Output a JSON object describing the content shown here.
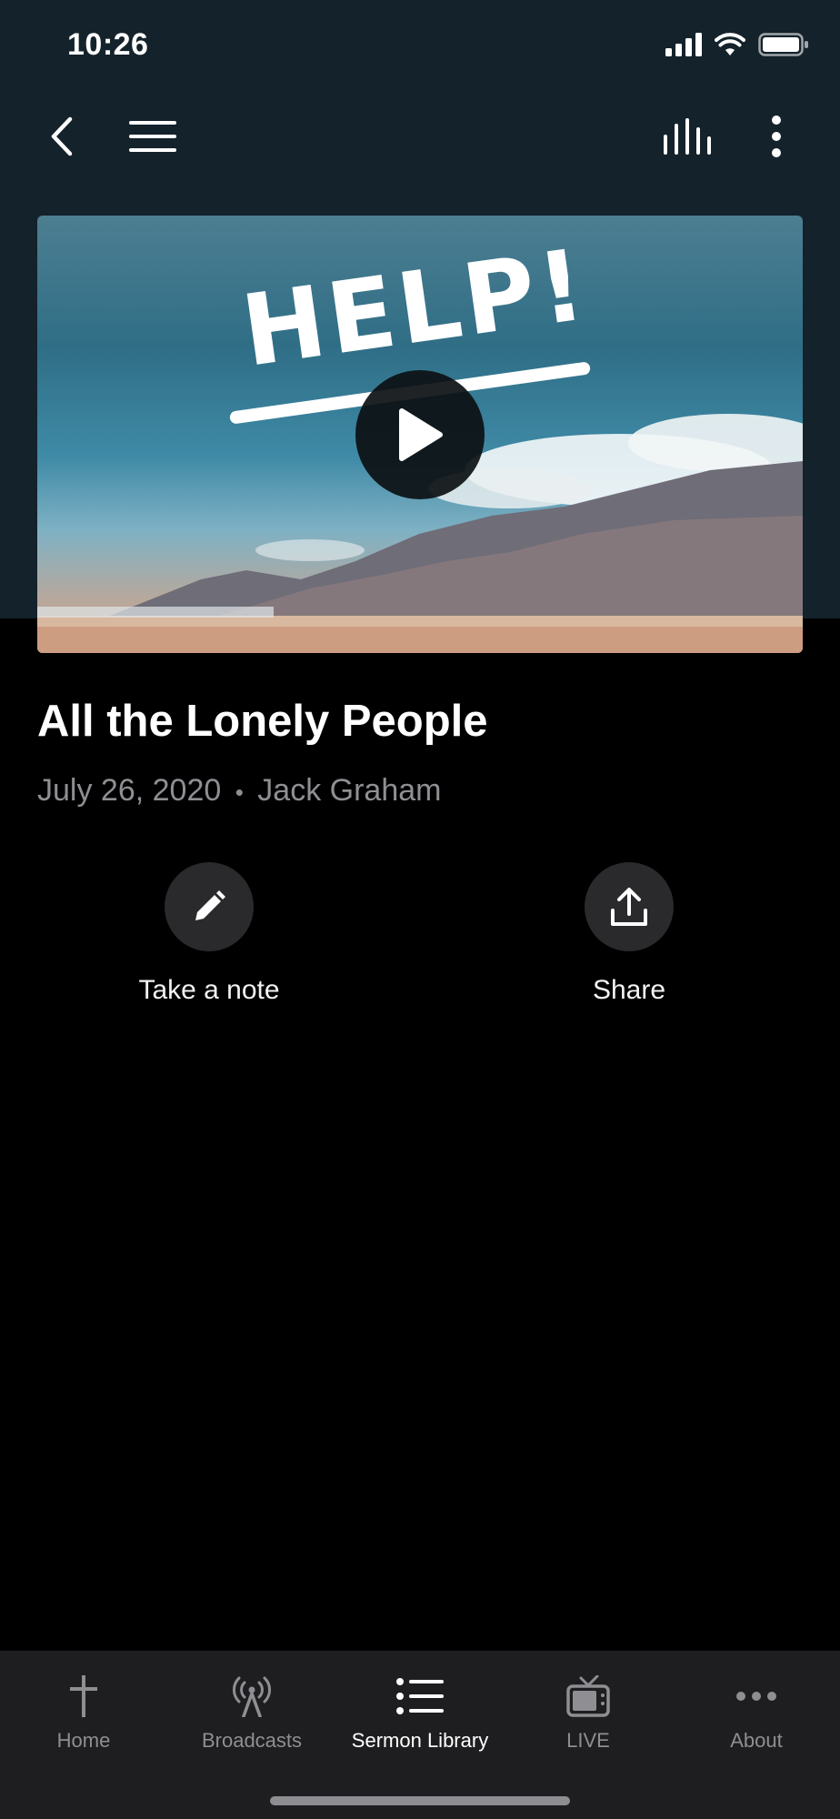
{
  "status_bar": {
    "time": "10:26"
  },
  "hero": {
    "title_art": "HELP!"
  },
  "sermon": {
    "title": "All the Lonely People",
    "date": "July 26, 2020",
    "separator": "•",
    "speaker": "Jack Graham"
  },
  "actions": [
    {
      "label": "Take a note",
      "icon": "pencil-icon"
    },
    {
      "label": "Share",
      "icon": "share-icon"
    }
  ],
  "tabs": [
    {
      "label": "Home",
      "icon": "cross-icon",
      "active": false
    },
    {
      "label": "Broadcasts",
      "icon": "broadcast-icon",
      "active": false
    },
    {
      "label": "Sermon Library",
      "icon": "list-icon",
      "active": true
    },
    {
      "label": "LIVE",
      "icon": "tv-icon",
      "active": false
    },
    {
      "label": "About",
      "icon": "more-icon",
      "active": false
    }
  ],
  "colors": {
    "header_bg": "#14222b",
    "page_bg": "#000000",
    "tabbar_bg": "#1e1e20",
    "muted_text": "#8e8e93"
  }
}
